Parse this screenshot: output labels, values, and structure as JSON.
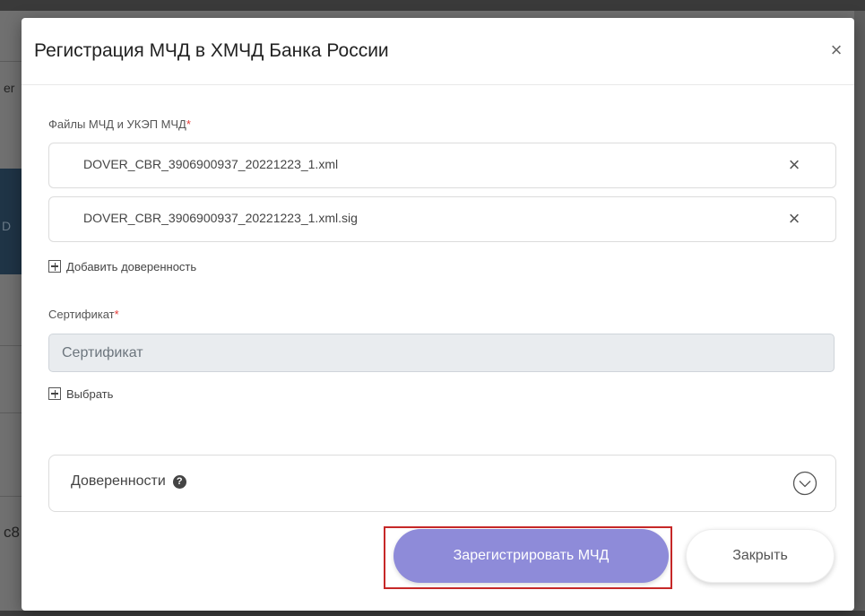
{
  "modal": {
    "title": "Регистрация МЧД в ХМЧД Банка России",
    "close_symbol": "×"
  },
  "files_section": {
    "label": "Файлы МЧД и УКЭП МЧД",
    "required_mark": "*",
    "files": [
      {
        "name": "DOVER_CBR_3906900937_20221223_1.xml",
        "remove_symbol": "×"
      },
      {
        "name": "DOVER_CBR_3906900937_20221223_1.xml.sig",
        "remove_symbol": "×"
      }
    ],
    "add_label": "Добавить доверенность"
  },
  "certificate_section": {
    "label": "Сертификат",
    "required_mark": "*",
    "placeholder": "Сертификат",
    "choose_label": "Выбрать"
  },
  "accordion": {
    "title": "Доверенности",
    "help_icon": "question-circle-icon",
    "toggle_icon": "chevron-down-circle-icon"
  },
  "actions": {
    "register_label": "Зарегистрировать МЧД",
    "close_label": "Закрыть"
  },
  "colors": {
    "primary_button": "#8e8bd9",
    "required": "#e53935",
    "highlight_frame": "#c62828"
  },
  "background": {
    "fragment_1": "er",
    "fragment_2": "D",
    "fragment_3": "c8"
  }
}
